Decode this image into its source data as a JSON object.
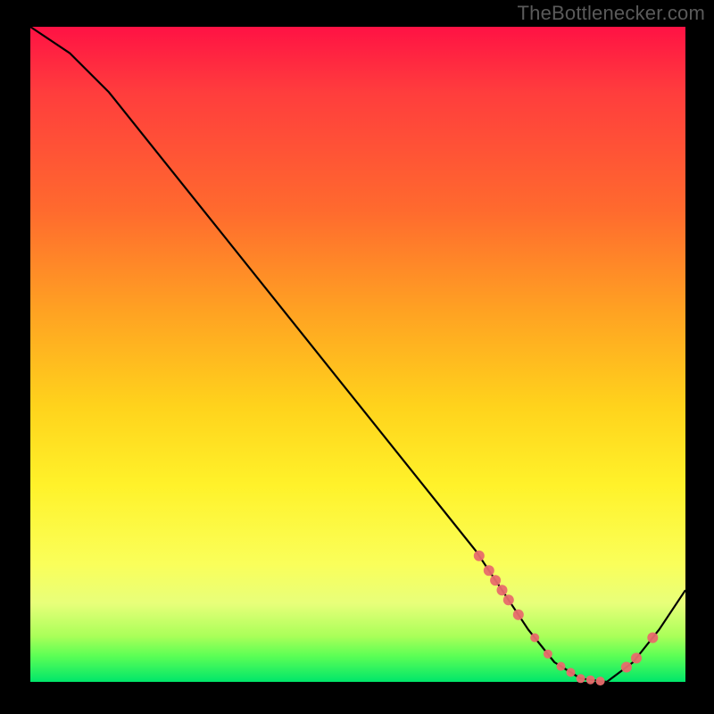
{
  "watermark": {
    "text": "TheBottlenecker.com"
  },
  "chart_data": {
    "type": "line",
    "title": "",
    "xlabel": "",
    "ylabel": "",
    "xlim": [
      0,
      100
    ],
    "ylim": [
      0,
      100
    ],
    "series": [
      {
        "name": "bottleneck-curve",
        "x": [
          0,
          6,
          12,
          20,
          30,
          40,
          50,
          60,
          68,
          72,
          76,
          80,
          84,
          88,
          92,
          96,
          100
        ],
        "y": [
          100,
          96,
          90,
          80,
          67.5,
          55,
          42.5,
          30,
          20,
          14,
          8,
          3,
          0.5,
          0,
          3,
          8,
          14
        ]
      }
    ],
    "markers": {
      "name": "highlight-points",
      "groupA_x": [
        68.5,
        70,
        71,
        72,
        73,
        74.5
      ],
      "groupB_x": [
        77,
        79,
        81,
        82.5,
        84,
        85.5,
        87
      ],
      "groupC_x": [
        91,
        92.5,
        95
      ]
    }
  },
  "colors": {
    "curve": "#000000",
    "marker": "#e86b6b",
    "background": "#000000"
  }
}
